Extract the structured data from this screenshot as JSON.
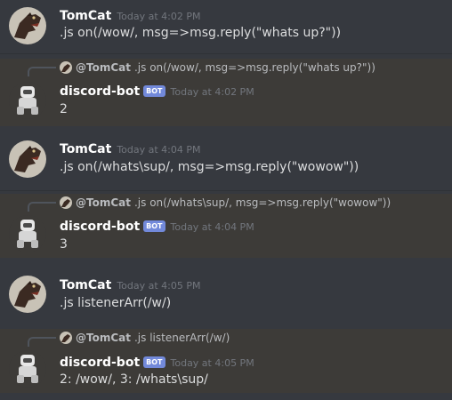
{
  "messages": [
    {
      "author": "TomCat",
      "timestamp": "Today at 4:02 PM",
      "content": ".js on(/wow/, msg=>msg.reply(\"whats up?\"))"
    },
    {
      "author": "discord-bot",
      "bot_tag": "BOT",
      "timestamp": "Today at 4:02 PM",
      "content": "2",
      "reply_to": {
        "author": "@TomCat",
        "text": ".js on(/wow/, msg=>msg.reply(\"whats up?\"))"
      }
    },
    {
      "author": "TomCat",
      "timestamp": "Today at 4:04 PM",
      "content": ".js on(/whats\\sup/, msg=>msg.reply(\"wowow\"))"
    },
    {
      "author": "discord-bot",
      "bot_tag": "BOT",
      "timestamp": "Today at 4:04 PM",
      "content": "3",
      "reply_to": {
        "author": "@TomCat",
        "text": ".js on(/whats\\sup/, msg=>msg.reply(\"wowow\"))"
      }
    },
    {
      "author": "TomCat",
      "timestamp": "Today at 4:05 PM",
      "content": ".js listenerArr(/w/)"
    },
    {
      "author": "discord-bot",
      "bot_tag": "BOT",
      "timestamp": "Today at 4:05 PM",
      "content": "2: /wow/, 3: /whats\\sup/",
      "reply_to": {
        "author": "@TomCat",
        "text": ".js listenerArr(/w/)"
      }
    }
  ],
  "colors": {
    "background": "#36393f",
    "highlight": "#3d3b38",
    "bot_tag": "#7289da",
    "timestamp": "#72767d"
  }
}
